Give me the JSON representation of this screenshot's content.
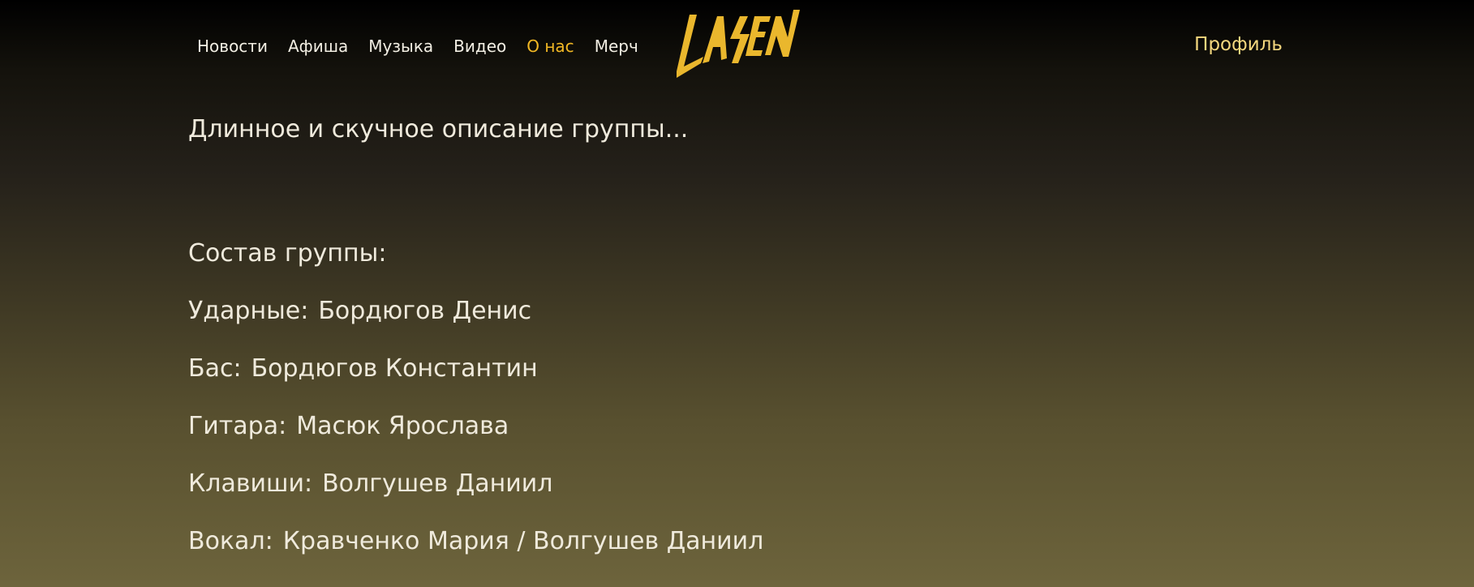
{
  "nav": {
    "items": [
      {
        "label": "Новости",
        "active": false
      },
      {
        "label": "Афиша",
        "active": false
      },
      {
        "label": "Музыка",
        "active": false
      },
      {
        "label": "Видео",
        "active": false
      },
      {
        "label": "О нас",
        "active": true
      },
      {
        "label": "Мерч",
        "active": false
      }
    ],
    "active_color": "#f2b824"
  },
  "logo": {
    "text": "LASEN",
    "color": "#eab72d"
  },
  "header": {
    "profile_label": "Профиль",
    "profile_color": "#f4d77e"
  },
  "main": {
    "description": "Длинное и скучное описание группы...",
    "lineup_title": "Состав группы:",
    "members": [
      {
        "role": "Ударные:",
        "name": "Бордюгов Денис"
      },
      {
        "role": "Бас:",
        "name": "Бордюгов Константин"
      },
      {
        "role": "Гитара:",
        "name": "Масюк Ярослава"
      },
      {
        "role": "Клавиши:",
        "name": "Волгушев Даниил"
      },
      {
        "role": "Вокал:",
        "name": "Кравченко Мария / Волгушев Даниил"
      }
    ]
  }
}
